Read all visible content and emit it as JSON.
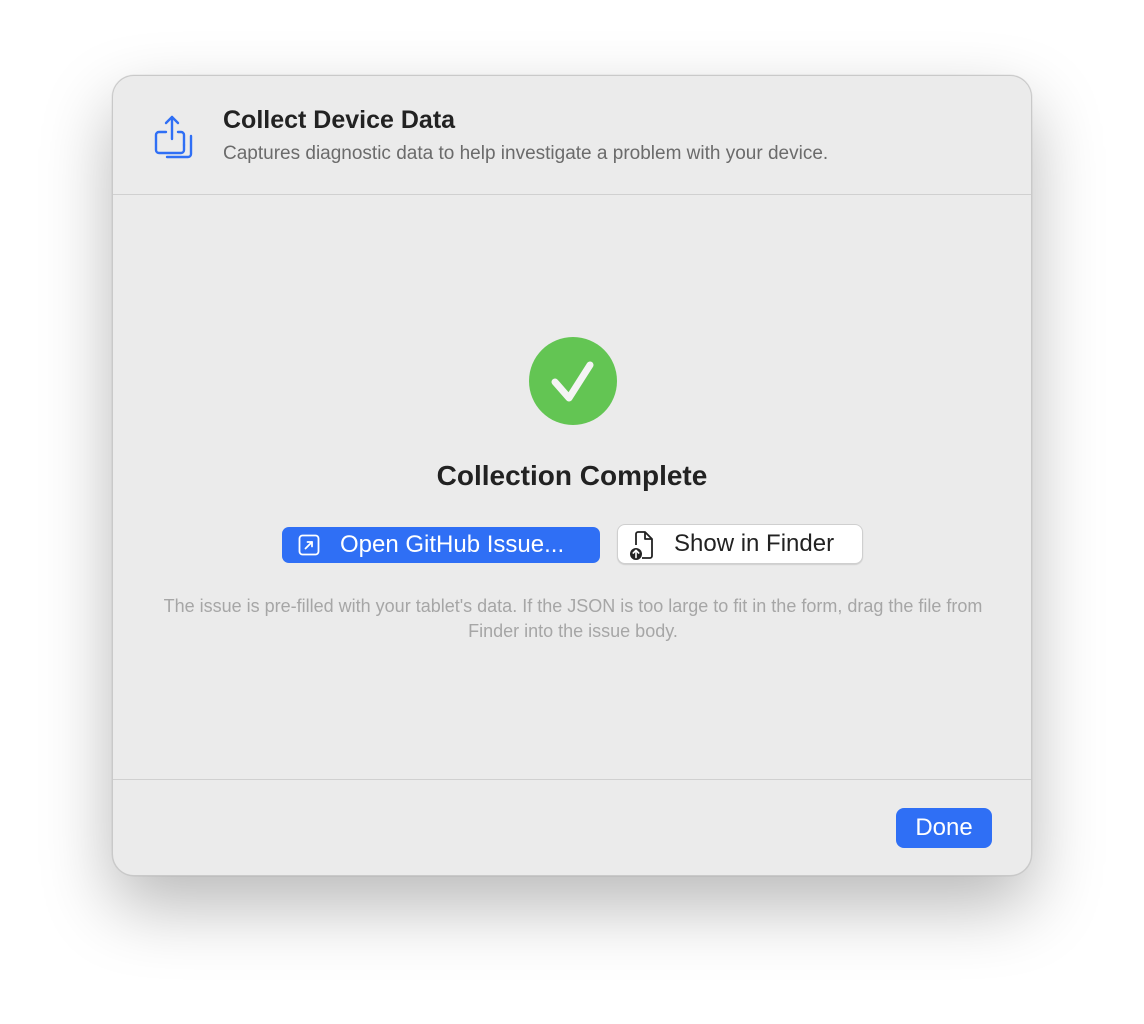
{
  "header": {
    "title": "Collect Device Data",
    "subtitle": "Captures diagnostic data to help investigate a problem with your device.",
    "icon": "square-and-arrow-up-on-square-icon"
  },
  "status": {
    "icon": "checkmark-circle-icon",
    "title": "Collection Complete",
    "color": "#63c553"
  },
  "actions": {
    "open_issue_label": "Open GitHub Issue...",
    "open_issue_icon": "arrow-up-right-square-icon",
    "show_finder_label": "Show in Finder",
    "show_finder_icon": "document-arrow-up-icon"
  },
  "help_text": "The issue is pre-filled with your tablet's data. If the JSON is too large to fit in the form, drag the file from Finder into the issue body.",
  "footer": {
    "done_label": "Done"
  },
  "colors": {
    "accent": "#2f6ff5",
    "success": "#63c553",
    "dialog_background": "#ebebeb"
  }
}
